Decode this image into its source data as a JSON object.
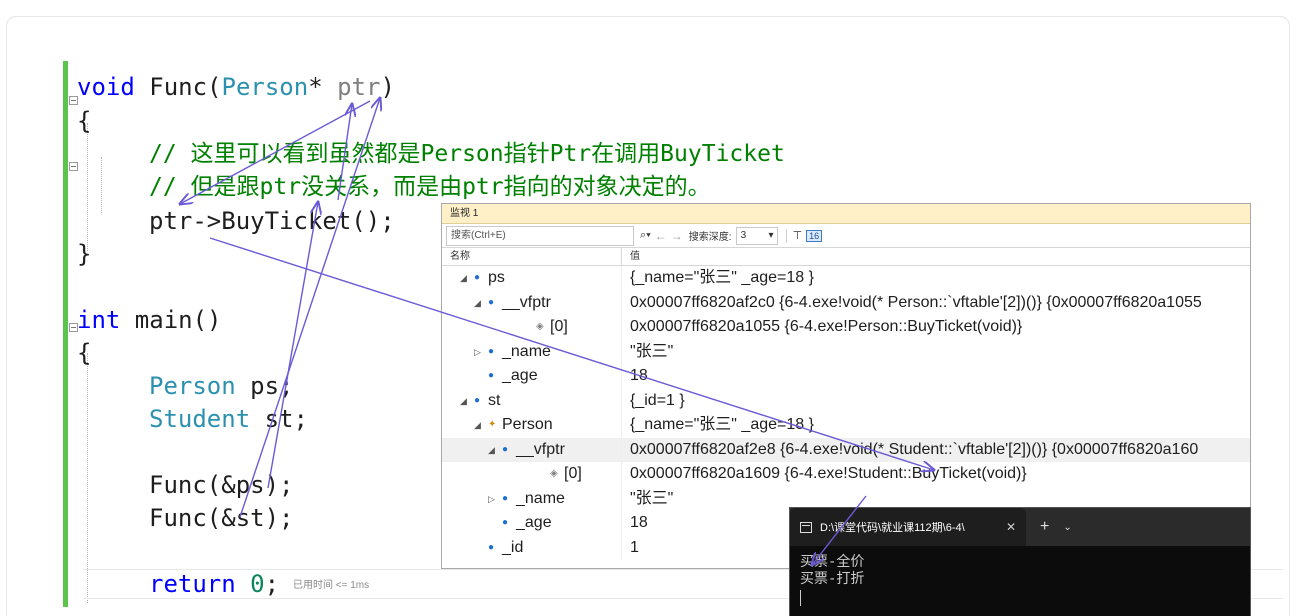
{
  "code": {
    "line1": {
      "kw": "void",
      "fn": " Func(",
      "type": "Person",
      "rest": "* ",
      "param": "ptr",
      "close": ")"
    },
    "line2": "{",
    "line3": "// 这里可以看到虽然都是Person指针Ptr在调用BuyTicket",
    "line4": "// 但是跟ptr没关系，而是由ptr指向的对象决定的。",
    "line5": "ptr->BuyTicket();",
    "line6": "}",
    "line7": {
      "kw": "int",
      "rest": " main()"
    },
    "line8": "{",
    "line9": {
      "type": "Person",
      "rest": " ps;"
    },
    "line10": {
      "type": "Student",
      "rest": " st;"
    },
    "line11": "Func(&ps);",
    "line12": "Func(&st);",
    "line13": {
      "kw": "return",
      "num": "0",
      "rest": ";"
    },
    "elapsed": "已用时间 <= 1ms"
  },
  "watch": {
    "title": "监视 1",
    "search_placeholder": "搜索(Ctrl+E)",
    "search_icon": "search-icon",
    "depth_label": "搜索深度:",
    "depth_value": "3",
    "col_name": "名称",
    "col_value": "值",
    "rows": [
      {
        "name": "ps",
        "value": "{_name=\"张三\" _age=18 }",
        "expander": "expanded",
        "icon": "field"
      },
      {
        "name": "__vfptr",
        "value": "0x00007ff6820af2c0 {6-4.exe!void(* Person::`vftable'[2])()} {0x00007ff6820a1055",
        "expander": "expanded",
        "icon": "field"
      },
      {
        "name": "[0]",
        "value": "0x00007ff6820a1055 {6-4.exe!Person::BuyTicket(void)}",
        "expander": "none",
        "icon": "elem"
      },
      {
        "name": "_name",
        "value": "\"张三\"",
        "expander": "collapsed",
        "icon": "field"
      },
      {
        "name": "_age",
        "value": "18",
        "expander": "none",
        "icon": "field"
      },
      {
        "name": "st",
        "value": "{_id=1 }",
        "expander": "expanded",
        "icon": "field"
      },
      {
        "name": "Person",
        "value": "{_name=\"张三\" _age=18 }",
        "expander": "expanded",
        "icon": "base"
      },
      {
        "name": "__vfptr",
        "value": "0x00007ff6820af2e8 {6-4.exe!void(* Student::`vftable'[2])()} {0x00007ff6820a160",
        "expander": "expanded",
        "icon": "field"
      },
      {
        "name": "[0]",
        "value": "0x00007ff6820a1609 {6-4.exe!Student::BuyTicket(void)}",
        "expander": "none",
        "icon": "elem"
      },
      {
        "name": "_name",
        "value": "\"张三\"",
        "expander": "collapsed",
        "icon": "field"
      },
      {
        "name": "_age",
        "value": "18",
        "expander": "none",
        "icon": "field"
      },
      {
        "name": "_id",
        "value": "1",
        "expander": "none",
        "icon": "field"
      }
    ]
  },
  "console": {
    "tab_title": "D:\\课堂代码\\就业课112期\\6-4\\",
    "output": [
      "买票-全价",
      "买票-打折"
    ]
  },
  "colors": {
    "keyword": "#0000ff",
    "type": "#2b91af",
    "comment": "#008000",
    "arrow": "#6a5ad6",
    "gutter": "#5cc34b"
  }
}
